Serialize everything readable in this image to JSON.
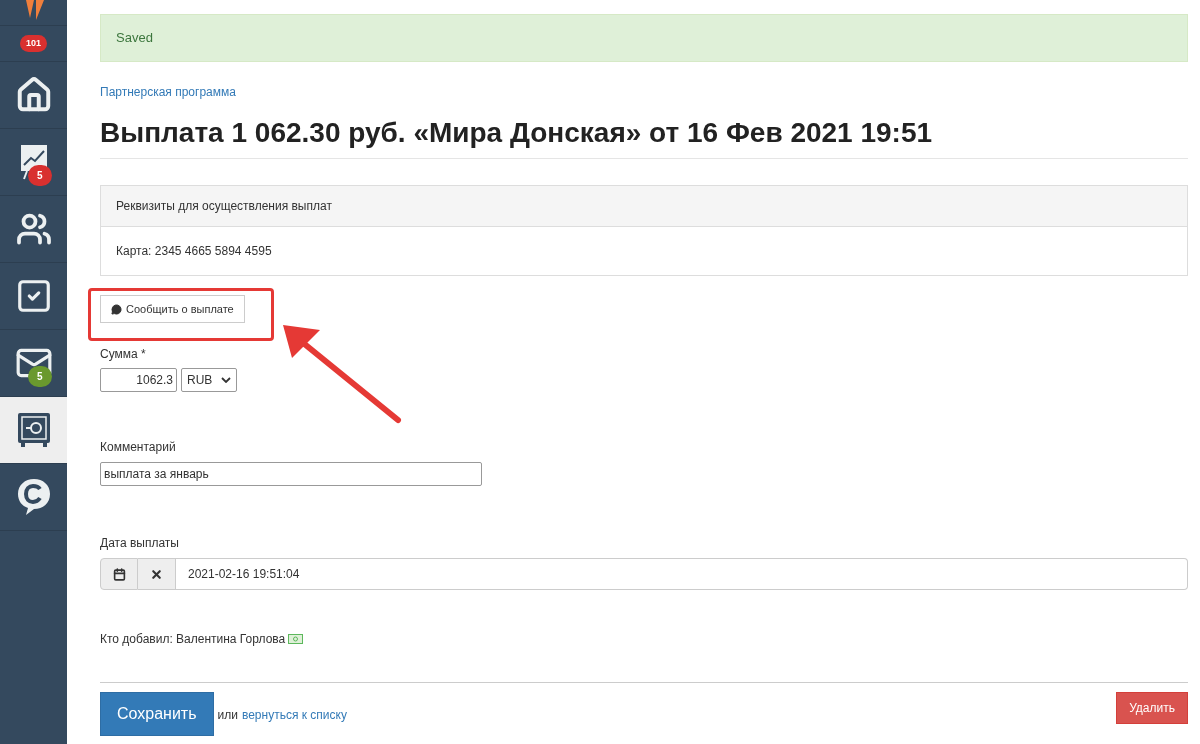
{
  "sidebar": {
    "badge": "101",
    "items": [
      {
        "kind": "home",
        "selected": false
      },
      {
        "kind": "chart",
        "selected": false,
        "badge": "5",
        "color": "#d9302f"
      },
      {
        "kind": "users",
        "selected": false
      },
      {
        "kind": "tasks",
        "selected": false
      },
      {
        "kind": "mail",
        "selected": false,
        "badge": "5",
        "color": "#6a992e"
      },
      {
        "kind": "safe",
        "selected": true
      },
      {
        "kind": "chat",
        "selected": false
      }
    ]
  },
  "alert": "Saved",
  "breadcrumb": "Партнерская программа",
  "title": "Выплата 1 062.30 руб. «Мира Донская» от 16 Фев 2021 19:51",
  "panel": {
    "heading": "Реквизиты для осуществления выплат",
    "body": "Карта: 2345 4665 5894 4595"
  },
  "notify_button": "Сообщить о выплате",
  "amount": {
    "label": "Сумма *",
    "value": "1062.3",
    "currency": "RUB"
  },
  "comment": {
    "label": "Комментарий",
    "value": "выплата за январь"
  },
  "date": {
    "label": "Дата выплаты",
    "value": "2021-02-16 19:51:04"
  },
  "added_by": "Кто добавил: Валентина Горлова",
  "save": "Сохранить",
  "or": "или",
  "back_link": "вернуться к списку",
  "delete": "Удалить"
}
